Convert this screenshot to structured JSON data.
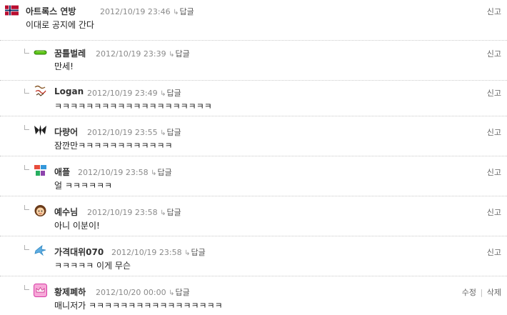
{
  "comments": [
    {
      "author": "아트록스 연방",
      "date": "2012/10/19 23:46",
      "reply_label": "답글",
      "report_label": "신고",
      "text": "이대로 공지에 간다",
      "icon": "norway-flag-icon"
    },
    {
      "author": "꿈틀벌레",
      "date": "2012/10/19 23:39",
      "reply_label": "답글",
      "report_label": "신고",
      "text": "만세!",
      "icon": "green-worm-icon"
    },
    {
      "author": "Logan",
      "date": "2012/10/19 23:49",
      "reply_label": "답글",
      "report_label": "신고",
      "text": "ㅋㅋㅋㅋㅋㅋㅋㅋㅋㅋㅋㅋㅋㅋㅋㅋㅋㅋㅋㅋ",
      "icon": "handwriting-avatar-icon"
    },
    {
      "author": "다량어",
      "date": "2012/10/19 23:55",
      "reply_label": "답글",
      "report_label": "신고",
      "text": "잠깐만ㅋㅋㅋㅋㅋㅋㅋㅋㅋㅋㅋㅋ",
      "icon": "dark-winged-emblem-icon"
    },
    {
      "author": "애플",
      "date": "2012/10/19 23:58",
      "reply_label": "답글",
      "report_label": "신고",
      "text": "얼 ㅋㅋㅋㅋㅋㅋ",
      "icon": "colorful-text-avatar-icon"
    },
    {
      "author": "예수님",
      "date": "2012/10/19 23:58",
      "reply_label": "답글",
      "report_label": "신고",
      "text": "아니 이분이!",
      "icon": "girl-face-avatar-icon"
    },
    {
      "author": "가격대위070",
      "date": "2012/10/19 23:58",
      "reply_label": "답글",
      "report_label": "신고",
      "text": "ㅋㅋㅋㅋㅋ 이게 무슨",
      "icon": "blue-splash-icon"
    },
    {
      "author": "황제폐하",
      "date": "2012/10/20 00:00",
      "reply_label": "답글",
      "edit_label": "수정",
      "separator": "|",
      "delete_label": "삭제",
      "text": "매니저가 ㅋㅋㅋㅋㅋㅋㅋㅋㅋㅋㅋㅋㅋㅋㅋㅋㅋ",
      "icon": "pink-crown-avatar-icon"
    }
  ]
}
